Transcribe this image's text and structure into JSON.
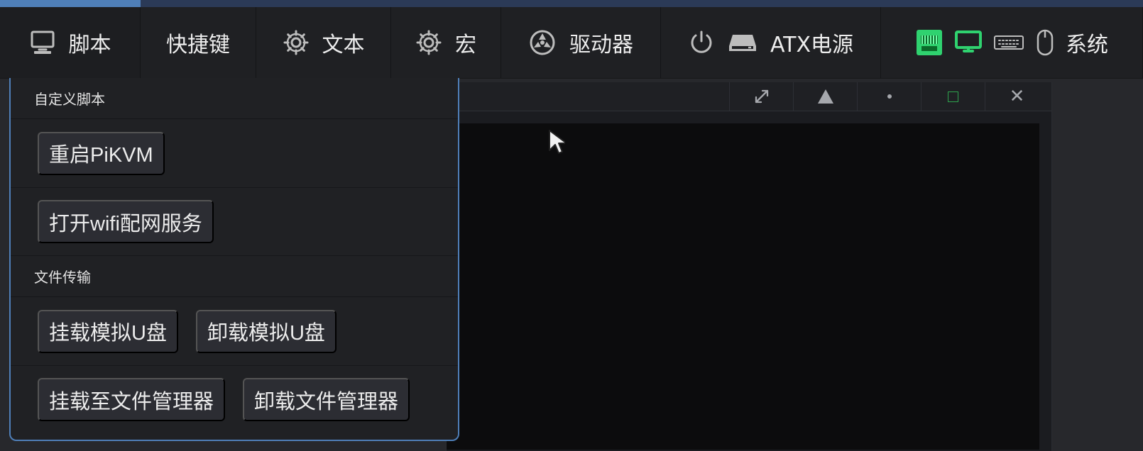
{
  "colors": {
    "accent_blue": "#4f7fb8",
    "status_green": "#2fd26f",
    "window_square_green": "#2ea24d"
  },
  "navbar": {
    "items": [
      {
        "label": "脚本",
        "icon": "monitor-keyboard-icon"
      },
      {
        "label": "快捷键",
        "icon": ""
      },
      {
        "label": "文本",
        "icon": "gear-icon"
      },
      {
        "label": "宏",
        "icon": "gear-icon"
      },
      {
        "label": "驱动器",
        "icon": "drive-icon"
      },
      {
        "label": "ATX电源",
        "icon": "power-icon"
      },
      {
        "label": "系统",
        "icon": "status-icons"
      }
    ],
    "atx_secondary_icon": "hard-drive-icon",
    "status_icons": [
      "ethernet-icon",
      "display-icon",
      "keyboard-icon",
      "mouse-icon"
    ]
  },
  "dropdown": {
    "sections": [
      {
        "title": "自定义脚本",
        "items": [
          "重启PiKVM",
          "打开wifi配网服务"
        ]
      },
      {
        "title": "文件传输",
        "items": [
          "挂载模拟U盘",
          "卸载模拟U盘",
          "挂载至文件管理器",
          "卸载文件管理器"
        ]
      }
    ]
  },
  "kvm_window": {
    "tools": [
      "expand-icon",
      "triangle-icon",
      "dot-icon",
      "square-icon",
      "close-icon"
    ],
    "close_symbol": "✕"
  }
}
